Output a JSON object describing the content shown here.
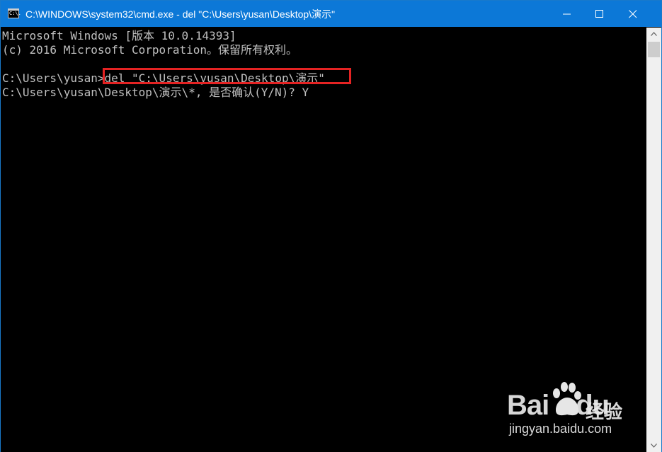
{
  "window": {
    "title": "C:\\WINDOWS\\system32\\cmd.exe - del  \"C:\\Users\\yusan\\Desktop\\演示\"",
    "icon": "cmd-icon",
    "icon_text": "C:\\."
  },
  "console": {
    "lines": [
      "Microsoft Windows [版本 10.0.14393]",
      "(c) 2016 Microsoft Corporation。保留所有权利。",
      "",
      "C:\\Users\\yusan>del \"C:\\Users\\yusan\\Desktop\\演示\"",
      "C:\\Users\\yusan\\Desktop\\演示\\*, 是否确认(Y/N)? Y"
    ],
    "text_color": "#c0c0c0",
    "background": "#000000"
  },
  "annotation": {
    "highlight_color": "#e52323",
    "target": "del command"
  },
  "watermark": {
    "brand": "Bai",
    "brand_suffix": "du",
    "jingyan": "经验",
    "url": "jingyan.baidu.com"
  },
  "colors": {
    "titlebar": "#0c78d7",
    "scrollbar": "#f0f0f0"
  }
}
